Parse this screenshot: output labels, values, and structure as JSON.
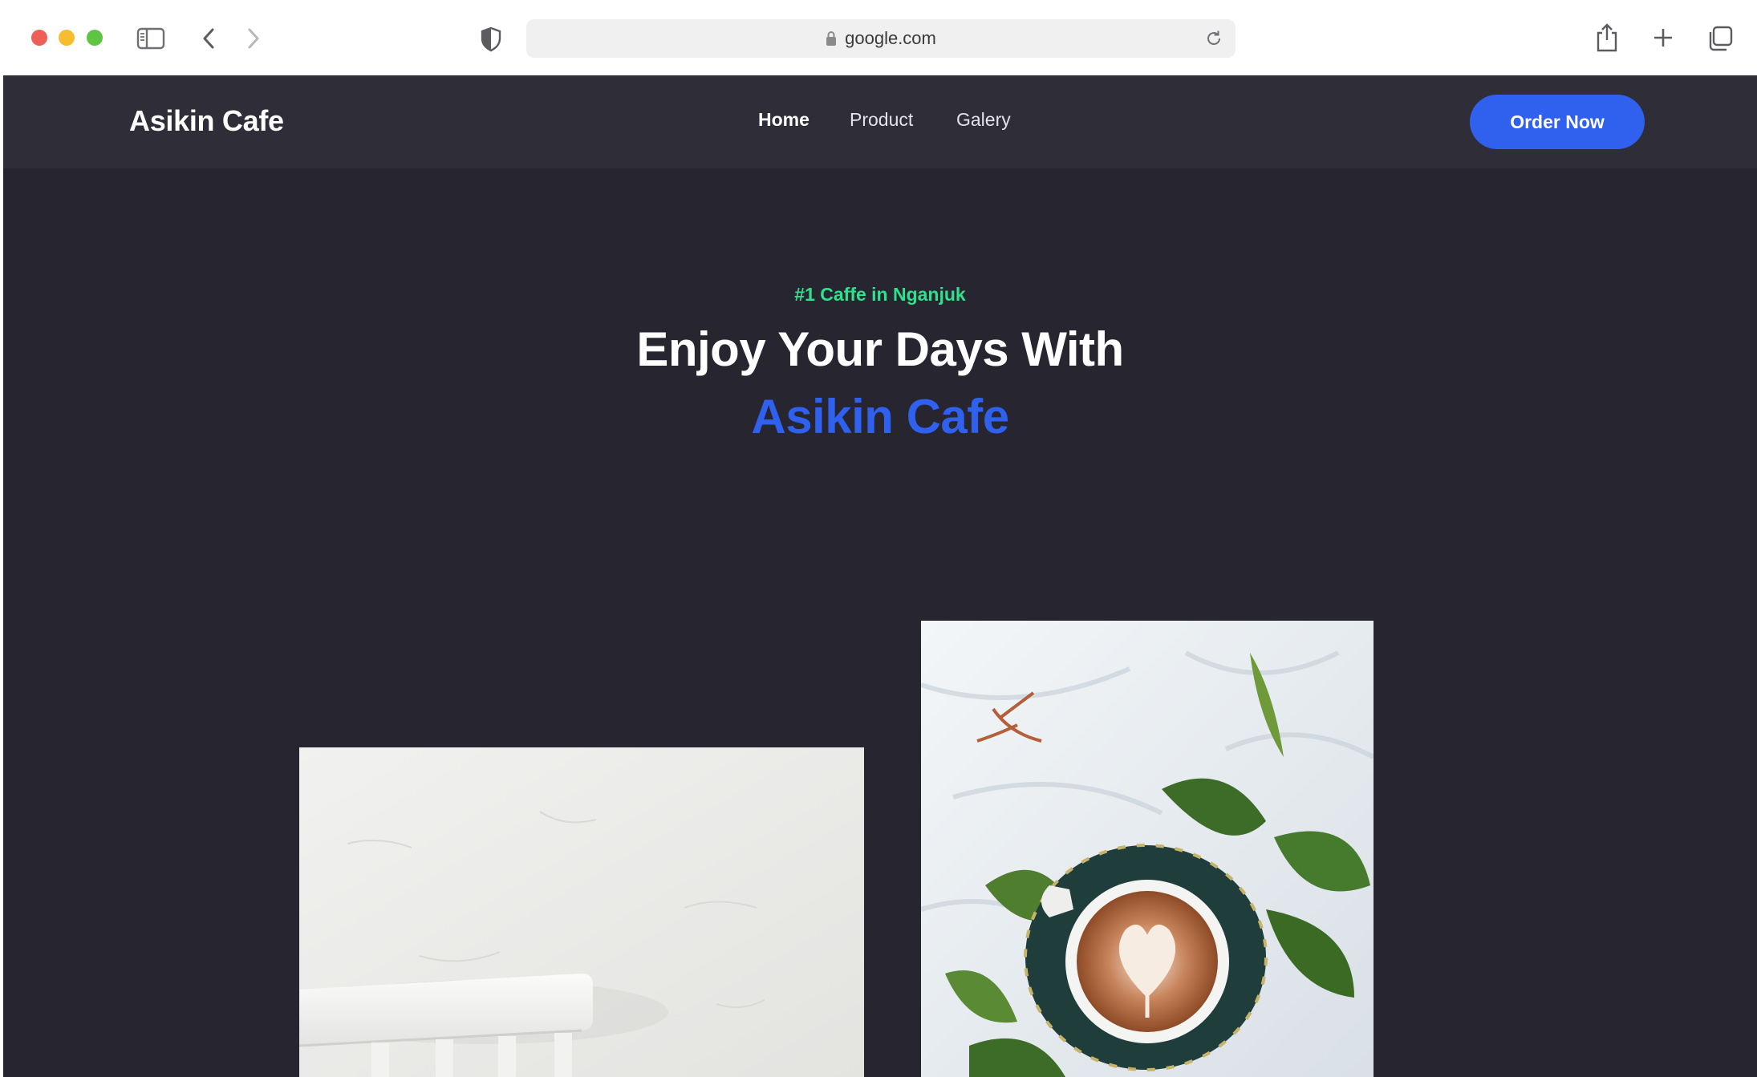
{
  "browser": {
    "url": "google.com",
    "icons": [
      "sidebar-icon",
      "back-icon",
      "forward-icon",
      "shield-icon",
      "lock-icon",
      "reload-icon",
      "share-icon",
      "new-tab-icon",
      "tabs-overview-icon"
    ]
  },
  "nav": {
    "brand": "Asikin Cafe",
    "items": [
      {
        "label": "Home",
        "active": true
      },
      {
        "label": "Product",
        "active": false
      },
      {
        "label": "Galery",
        "active": false
      }
    ],
    "cta": "Order Now"
  },
  "hero": {
    "tag": "#1 Caffe in Nganjuk",
    "title": "Enjoy Your Days With",
    "accent": "Asikin Cafe"
  },
  "colors": {
    "page_bg": "#272630",
    "nav_bg": "#2e2d38",
    "accent": "#2f60ee",
    "tag": "#2fe08d"
  },
  "images": [
    "white-chair-photo",
    "latte-art-coffee-photo"
  ]
}
